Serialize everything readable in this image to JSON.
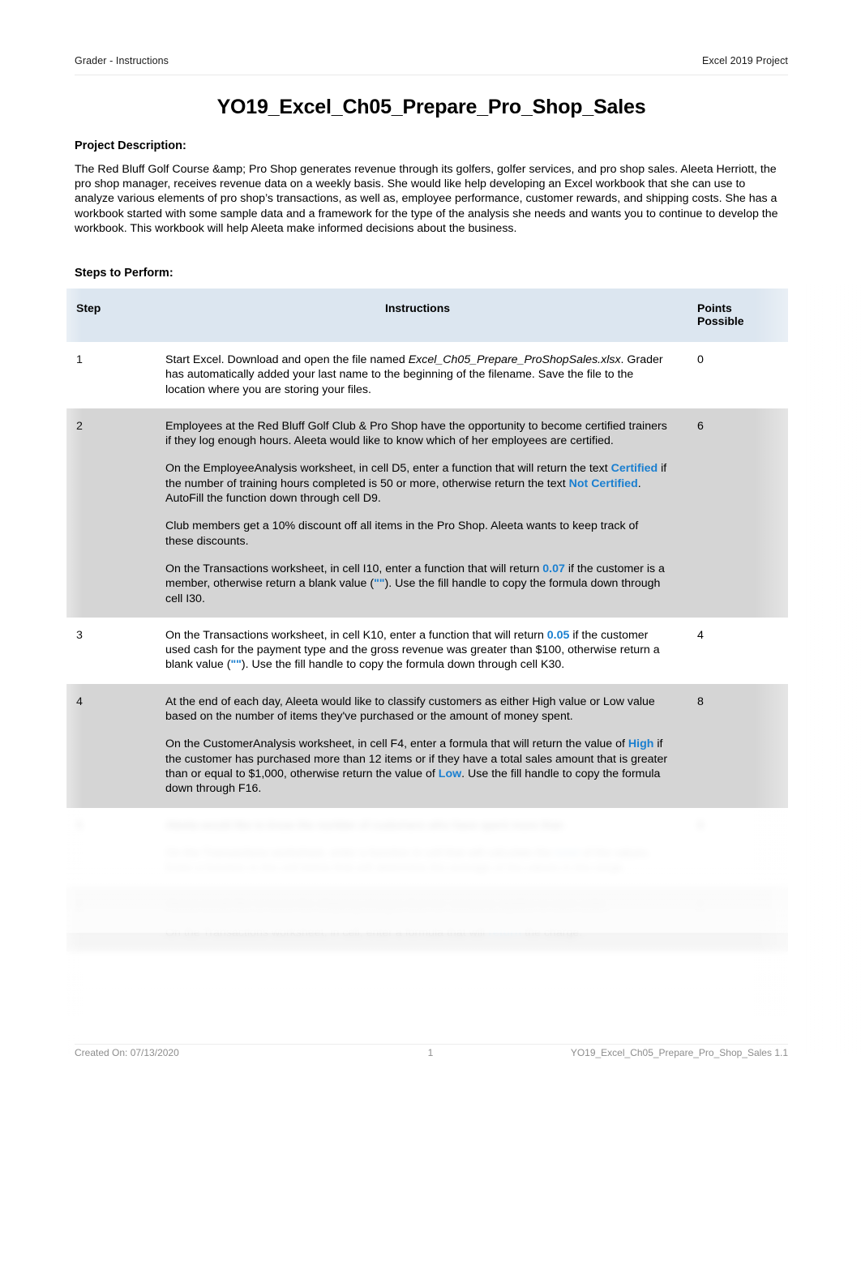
{
  "header": {
    "left_label": "Grader - Instructions",
    "right_label": "Excel 2019 Project"
  },
  "title": "YO19_Excel_Ch05_Prepare_Pro_Shop_Sales",
  "project_description": {
    "heading": "Project Description:",
    "body": "The Red Bluff Golf Course &amp; Pro Shop generates revenue through its golfers, golfer services, and pro shop sales. Aleeta Herriott, the pro shop manager, receives revenue data on a weekly basis. She would like help developing an Excel workbook that she can use to analyze various elements of pro shop’s transactions, as well as, employee performance, customer rewards, and shipping costs. She has a workbook started with some sample data and a framework for the type of the analysis she needs and wants you to continue to develop the workbook. This workbook will help Aleeta make informed decisions about the business."
  },
  "steps_section": {
    "heading": "Steps to Perform:",
    "columns": {
      "step": "Step",
      "instructions": "Instructions",
      "points": "Points\nPossible",
      "points_line1": "Points",
      "points_line2": "Possible"
    },
    "rows": [
      {
        "step": "1",
        "points": "0",
        "shaded": false,
        "obscured": false,
        "paragraphs": [
          {
            "runs": [
              {
                "text": "Start Excel. Download and open the file named ",
                "style": "normal"
              },
              {
                "text": "Excel_Ch05_Prepare_ProShopSales.xlsx",
                "style": "italic"
              },
              {
                "text": ". Grader has automatically added your last name to the beginning of the filename. Save the file to the location where you are storing your files.",
                "style": "normal"
              }
            ]
          }
        ]
      },
      {
        "step": "2",
        "points": "6",
        "shaded": true,
        "obscured": false,
        "paragraphs": [
          {
            "runs": [
              {
                "text": "Employees at the Red Bluff Golf Club & Pro Shop have the opportunity to become certified trainers if they log enough hours. Aleeta would like to know which of her employees are certified.",
                "style": "normal"
              }
            ]
          },
          {
            "runs": [
              {
                "text": "On the EmployeeAnalysis worksheet, in cell D5, enter a function that will return the text ",
                "style": "normal"
              },
              {
                "text": "Certified",
                "style": "keyword"
              },
              {
                "text": " if the number of training hours completed is 50 or more, otherwise return the text ",
                "style": "normal"
              },
              {
                "text": "Not Certified",
                "style": "keyword"
              },
              {
                "text": ". AutoFill the function down through cell D9.",
                "style": "normal"
              }
            ]
          },
          {
            "runs": [
              {
                "text": "Club members get a 10% discount off all items in the Pro Shop. Aleeta wants to keep track of these discounts.",
                "style": "normal"
              }
            ]
          },
          {
            "runs": [
              {
                "text": "On the Transactions worksheet, in cell I10, enter a function that will return ",
                "style": "normal"
              },
              {
                "text": "0.07",
                "style": "keyword"
              },
              {
                "text": " if the customer is a member, otherwise return a blank value (",
                "style": "normal"
              },
              {
                "text": "\"\"",
                "style": "keyword"
              },
              {
                "text": "). Use the fill handle to copy the formula down through cell I30.",
                "style": "normal"
              }
            ]
          }
        ]
      },
      {
        "step": "3",
        "points": "4",
        "shaded": false,
        "obscured": false,
        "paragraphs": [
          {
            "runs": [
              {
                "text": "On the Transactions worksheet, in cell K10, enter a function that will return ",
                "style": "normal"
              },
              {
                "text": "0.05",
                "style": "keyword"
              },
              {
                "text": " if the customer used cash for the payment type and the gross revenue was greater than $100, otherwise return a blank value (",
                "style": "normal"
              },
              {
                "text": "\"\"",
                "style": "keyword"
              },
              {
                "text": "). Use the fill handle to copy the formula down through cell K30.",
                "style": "normal"
              }
            ]
          }
        ]
      },
      {
        "step": "4",
        "points": "8",
        "shaded": true,
        "obscured": false,
        "paragraphs": [
          {
            "runs": [
              {
                "text": "At the end of each day, Aleeta would like to classify customers as either High value or Low value based on the number of items they've purchased or the amount of money spent.",
                "style": "normal"
              }
            ]
          },
          {
            "runs": [
              {
                "text": "On the CustomerAnalysis worksheet, in cell F4, enter a formula that will return the value of ",
                "style": "normal"
              },
              {
                "text": "High",
                "style": "keyword"
              },
              {
                "text": " if the customer has purchased more than 12 items or if they have a total sales amount that is greater than or equal to $1,000, otherwise return the value of ",
                "style": "normal"
              },
              {
                "text": "Low",
                "style": "keyword"
              },
              {
                "text": ". Use the fill handle to copy the formula down through F16.",
                "style": "normal"
              }
            ]
          }
        ]
      },
      {
        "step": "5",
        "points": "8",
        "shaded": false,
        "obscured": true,
        "paragraphs": [
          {
            "runs": [
              {
                "text": "Aleeta would like to know the number of customers who have spent more than",
                "style": "normal"
              }
            ]
          },
          {
            "runs": [
              {
                "text": "On the Transactions worksheet, enter a function in cell that will calculate the ",
                "style": "normal"
              },
              {
                "text": "total",
                "style": "keyword"
              },
              {
                "text": " of the values. Enter a function in the cell below that will determine the average of the values in the range.",
                "style": "normal"
              }
            ]
          }
        ]
      },
      {
        "step": "6",
        "points": "6",
        "shaded": true,
        "obscured": true,
        "paragraphs": [
          {
            "runs": [
              {
                "text": "Aleeta would like to know the shipping charges that her company applies to each order.",
                "style": "normal"
              }
            ]
          },
          {
            "runs": [
              {
                "text": "On the Transactions worksheet, in cell, enter a formula that will ",
                "style": "normal"
              },
              {
                "text": "return",
                "style": "keyword"
              },
              {
                "text": " the charge.",
                "style": "normal"
              }
            ]
          }
        ]
      }
    ]
  },
  "footer": {
    "left": "Created On: 07/13/2020",
    "center": "1",
    "right": "YO19_Excel_Ch05_Prepare_Pro_Shop_Sales 1.1"
  },
  "colors": {
    "keyword_blue": "#1a7fd0",
    "table_header_bg": "#dce6f0",
    "shaded_row_bg": "#d5d5d5",
    "page_bg": "#ffffff",
    "text": "#000000"
  }
}
